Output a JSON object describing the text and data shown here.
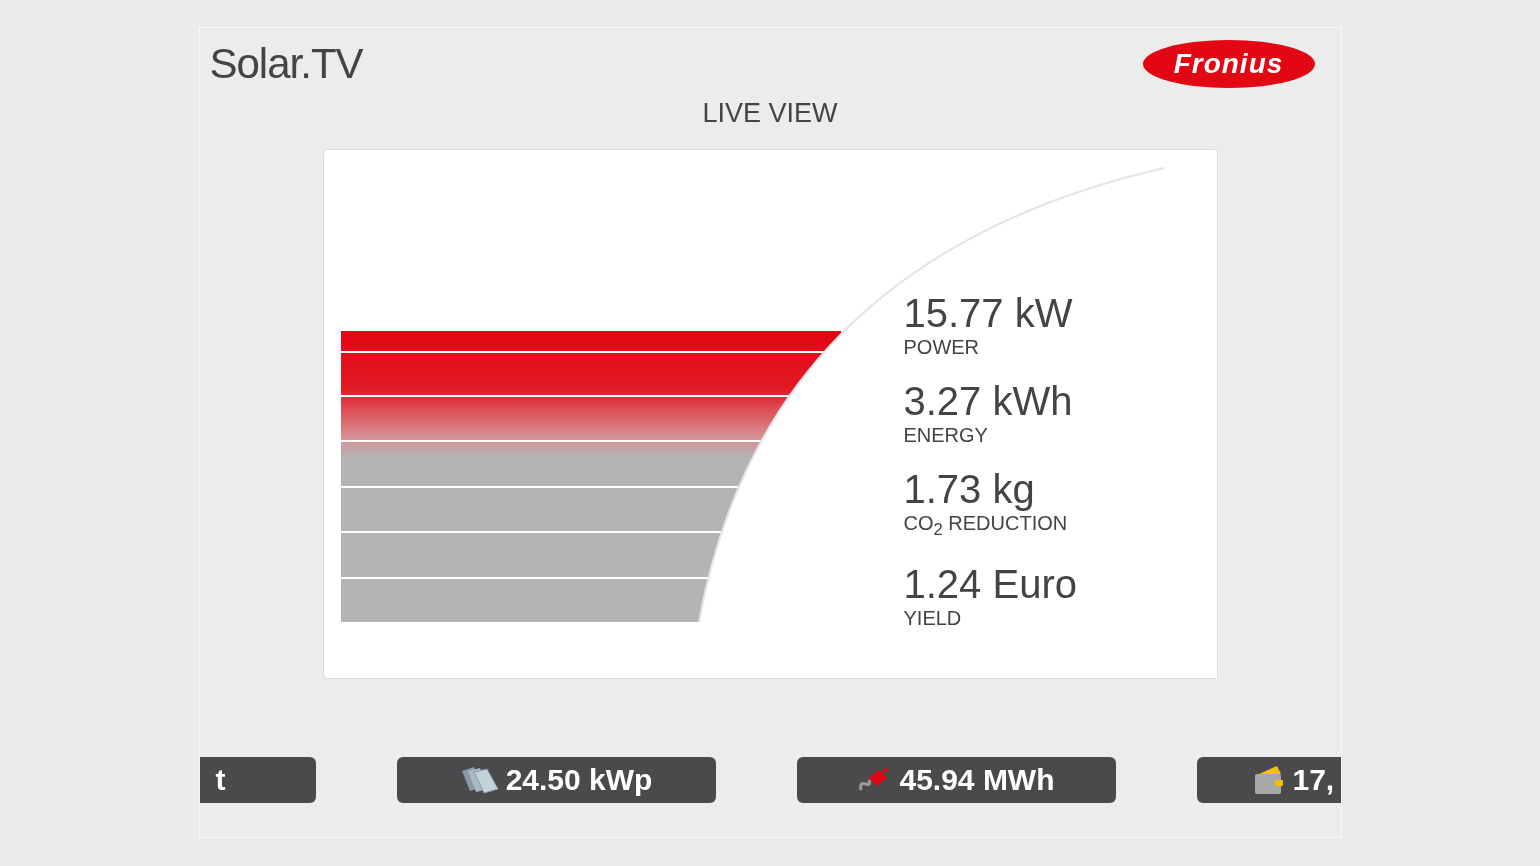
{
  "header": {
    "title": "Solar.TV",
    "logo": "Fronius"
  },
  "view_title": "LIVE VIEW",
  "readings": [
    {
      "value": "15.77 kW",
      "label": "POWER"
    },
    {
      "value": "3.27 kWh",
      "label": "ENERGY"
    },
    {
      "value": "1.73 kg",
      "label": "CO$_{2}$ REDUCTION"
    },
    {
      "value": "1.24 Euro",
      "label": "YIELD"
    }
  ],
  "tiles": [
    {
      "kind": "partial-left",
      "value": "t"
    },
    {
      "kind": "panels",
      "value": "24.50 kWp"
    },
    {
      "kind": "plug",
      "value": "45.94 MWh"
    },
    {
      "kind": "wallet",
      "value": "17,"
    }
  ]
}
